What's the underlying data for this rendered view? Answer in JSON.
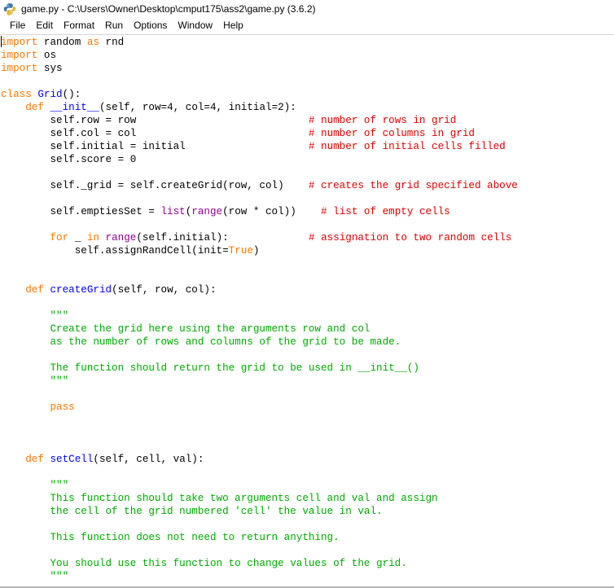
{
  "window": {
    "title": "game.py - C:\\Users\\Owner\\Desktop\\cmput175\\ass2\\game.py (3.6.2)",
    "icon": "python-idle-icon"
  },
  "menubar": {
    "items": [
      {
        "label": "File"
      },
      {
        "label": "Edit"
      },
      {
        "label": "Format"
      },
      {
        "label": "Run"
      },
      {
        "label": "Options"
      },
      {
        "label": "Window"
      },
      {
        "label": "Help"
      }
    ]
  },
  "colors": {
    "keyword": "#ff7700",
    "builtin": "#900090",
    "definition": "#0000ff",
    "comment": "#dd0000",
    "string": "#00aa00",
    "plain": "#000000",
    "background": "#ffffff"
  },
  "editor": {
    "caret_line": 1,
    "caret_column": 0,
    "lines": [
      [
        {
          "t": "import",
          "c": "kw"
        },
        {
          "t": " random ",
          "c": "pln"
        },
        {
          "t": "as",
          "c": "kw"
        },
        {
          "t": " rnd",
          "c": "pln"
        }
      ],
      [
        {
          "t": "import",
          "c": "kw"
        },
        {
          "t": " os",
          "c": "pln"
        }
      ],
      [
        {
          "t": "import",
          "c": "kw"
        },
        {
          "t": " sys",
          "c": "pln"
        }
      ],
      [],
      [
        {
          "t": "class",
          "c": "kw"
        },
        {
          "t": " ",
          "c": "pln"
        },
        {
          "t": "Grid",
          "c": "defn"
        },
        {
          "t": "():",
          "c": "pln"
        }
      ],
      [
        {
          "t": "    ",
          "c": "pln"
        },
        {
          "t": "def",
          "c": "kw"
        },
        {
          "t": " ",
          "c": "pln"
        },
        {
          "t": "__init__",
          "c": "defn"
        },
        {
          "t": "(self, row=4, col=4, initial=2):",
          "c": "pln"
        }
      ],
      [
        {
          "t": "        self.row = row",
          "c": "pln"
        },
        {
          "t": "                            ",
          "c": "pln"
        },
        {
          "t": "# number of rows in grid",
          "c": "cmt"
        }
      ],
      [
        {
          "t": "        self.col = col",
          "c": "pln"
        },
        {
          "t": "                            ",
          "c": "pln"
        },
        {
          "t": "# number of columns in grid",
          "c": "cmt"
        }
      ],
      [
        {
          "t": "        self.initial = initial",
          "c": "pln"
        },
        {
          "t": "                    ",
          "c": "pln"
        },
        {
          "t": "# number of initial cells filled",
          "c": "cmt"
        }
      ],
      [
        {
          "t": "        self.score = 0",
          "c": "pln"
        }
      ],
      [],
      [
        {
          "t": "        self._grid = self.createGrid(row, col)",
          "c": "pln"
        },
        {
          "t": "    ",
          "c": "pln"
        },
        {
          "t": "# creates the grid specified above",
          "c": "cmt"
        }
      ],
      [],
      [
        {
          "t": "        self.emptiesSet = ",
          "c": "pln"
        },
        {
          "t": "list",
          "c": "bi"
        },
        {
          "t": "(",
          "c": "pln"
        },
        {
          "t": "range",
          "c": "bi"
        },
        {
          "t": "(row * col))",
          "c": "pln"
        },
        {
          "t": "    ",
          "c": "pln"
        },
        {
          "t": "# list of empty cells",
          "c": "cmt"
        }
      ],
      [],
      [
        {
          "t": "        ",
          "c": "pln"
        },
        {
          "t": "for",
          "c": "kw"
        },
        {
          "t": " _ ",
          "c": "pln"
        },
        {
          "t": "in",
          "c": "kw"
        },
        {
          "t": " ",
          "c": "pln"
        },
        {
          "t": "range",
          "c": "bi"
        },
        {
          "t": "(self.initial):",
          "c": "pln"
        },
        {
          "t": "             ",
          "c": "pln"
        },
        {
          "t": "# assignation to two random cells",
          "c": "cmt"
        }
      ],
      [
        {
          "t": "            self.assignRandCell(init=",
          "c": "pln"
        },
        {
          "t": "True",
          "c": "kw"
        },
        {
          "t": ")",
          "c": "pln"
        }
      ],
      [],
      [],
      [
        {
          "t": "    ",
          "c": "pln"
        },
        {
          "t": "def",
          "c": "kw"
        },
        {
          "t": " ",
          "c": "pln"
        },
        {
          "t": "createGrid",
          "c": "defn"
        },
        {
          "t": "(self, row, col):",
          "c": "pln"
        }
      ],
      [],
      [
        {
          "t": "        \"\"\"",
          "c": "str"
        }
      ],
      [
        {
          "t": "        Create the grid here using the arguments row and col",
          "c": "str"
        }
      ],
      [
        {
          "t": "        as the number of rows and columns of the grid to be made.",
          "c": "str"
        }
      ],
      [],
      [
        {
          "t": "        The function should return the grid to be used in __init__()",
          "c": "str"
        }
      ],
      [
        {
          "t": "        \"\"\"",
          "c": "str"
        }
      ],
      [],
      [
        {
          "t": "        ",
          "c": "pln"
        },
        {
          "t": "pass",
          "c": "kw"
        }
      ],
      [],
      [],
      [],
      [
        {
          "t": "    ",
          "c": "pln"
        },
        {
          "t": "def",
          "c": "kw"
        },
        {
          "t": " ",
          "c": "pln"
        },
        {
          "t": "setCell",
          "c": "defn"
        },
        {
          "t": "(self, cell, val):",
          "c": "pln"
        }
      ],
      [],
      [
        {
          "t": "        \"\"\"",
          "c": "str"
        }
      ],
      [
        {
          "t": "        This function should take two arguments cell and val and assign",
          "c": "str"
        }
      ],
      [
        {
          "t": "        the cell of the grid numbered 'cell' the value in val.",
          "c": "str"
        }
      ],
      [],
      [
        {
          "t": "        This function does not need to return anything.",
          "c": "str"
        }
      ],
      [],
      [
        {
          "t": "        You should use this function to change values of the grid.",
          "c": "str"
        }
      ],
      [
        {
          "t": "        \"\"\"",
          "c": "str"
        }
      ]
    ]
  }
}
